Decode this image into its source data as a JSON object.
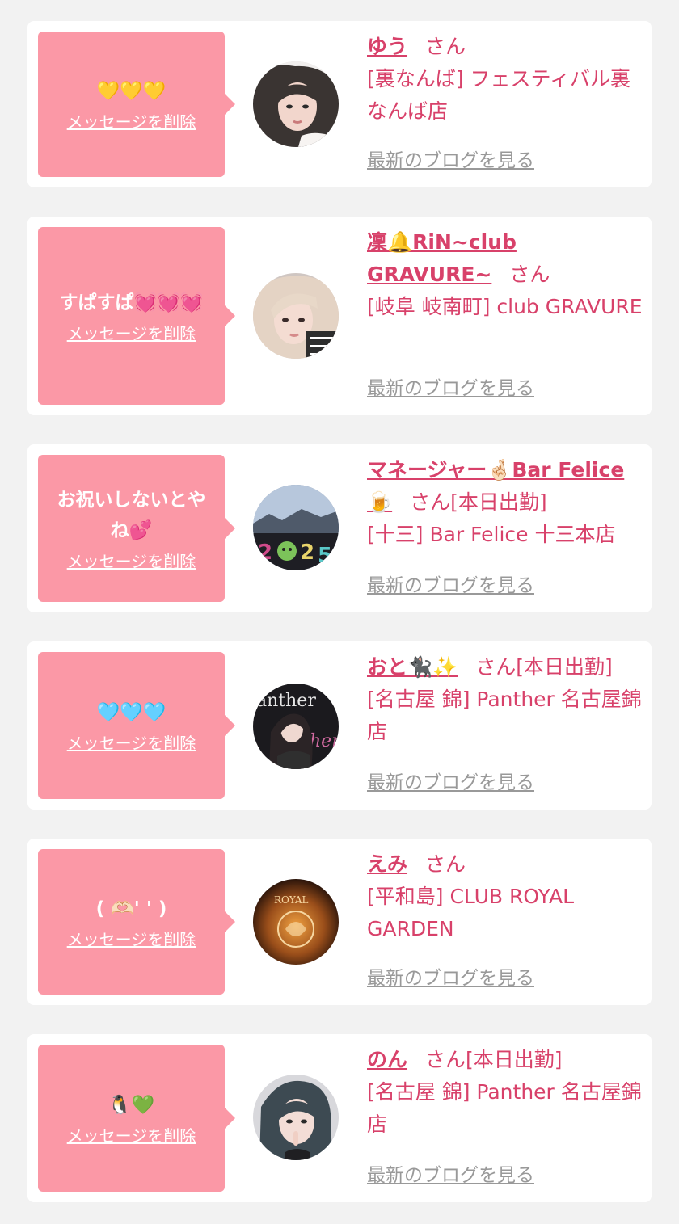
{
  "colors": {
    "accent": "#d8416a",
    "bubble": "#fb98a6",
    "muted": "#999999"
  },
  "common": {
    "delete_label": "メッセージを削除",
    "blog_label": "最新のブログを見る",
    "honorific": "さん",
    "today_badge": "[本日出勤]"
  },
  "cards": [
    {
      "message": "💛💛💛",
      "name": "ゆう",
      "today": "",
      "store": "[裏なんば] フェスティバル裏なんば店",
      "avatar_icon": "girl-portrait-icon"
    },
    {
      "message": "すぱすぱ💓💓💓",
      "name": "凜🔔RiN~club GRAVURE~",
      "today": "",
      "store": "[岐阜 岐南町] club GRAVURE",
      "avatar_icon": "blonde-girl-portrait-icon"
    },
    {
      "message": "お祝いしないとやね💕",
      "name": "マネージャー🤞🏻Bar Felice 🍺",
      "today": "[本日出勤]",
      "store": "[十三] Bar Felice 十三本店",
      "avatar_icon": "new-year-2025-icon"
    },
    {
      "message": "🩵🩵🩵",
      "name": "おと🐈‍⬛✨",
      "today": "[本日出勤]",
      "store": "[名古屋 錦] Panther 名古屋錦店",
      "avatar_icon": "panther-cast-icon"
    },
    {
      "message": "( 🫶🏻' ' )",
      "name": "えみ",
      "today": "",
      "store": "[平和島] CLUB ROYAL GARDEN",
      "avatar_icon": "royal-garden-logo-icon"
    },
    {
      "message": "🐧💚",
      "name": "のん",
      "today": "[本日出勤]",
      "store": "[名古屋 錦] Panther 名古屋錦店",
      "avatar_icon": "dark-hair-girl-icon"
    }
  ]
}
